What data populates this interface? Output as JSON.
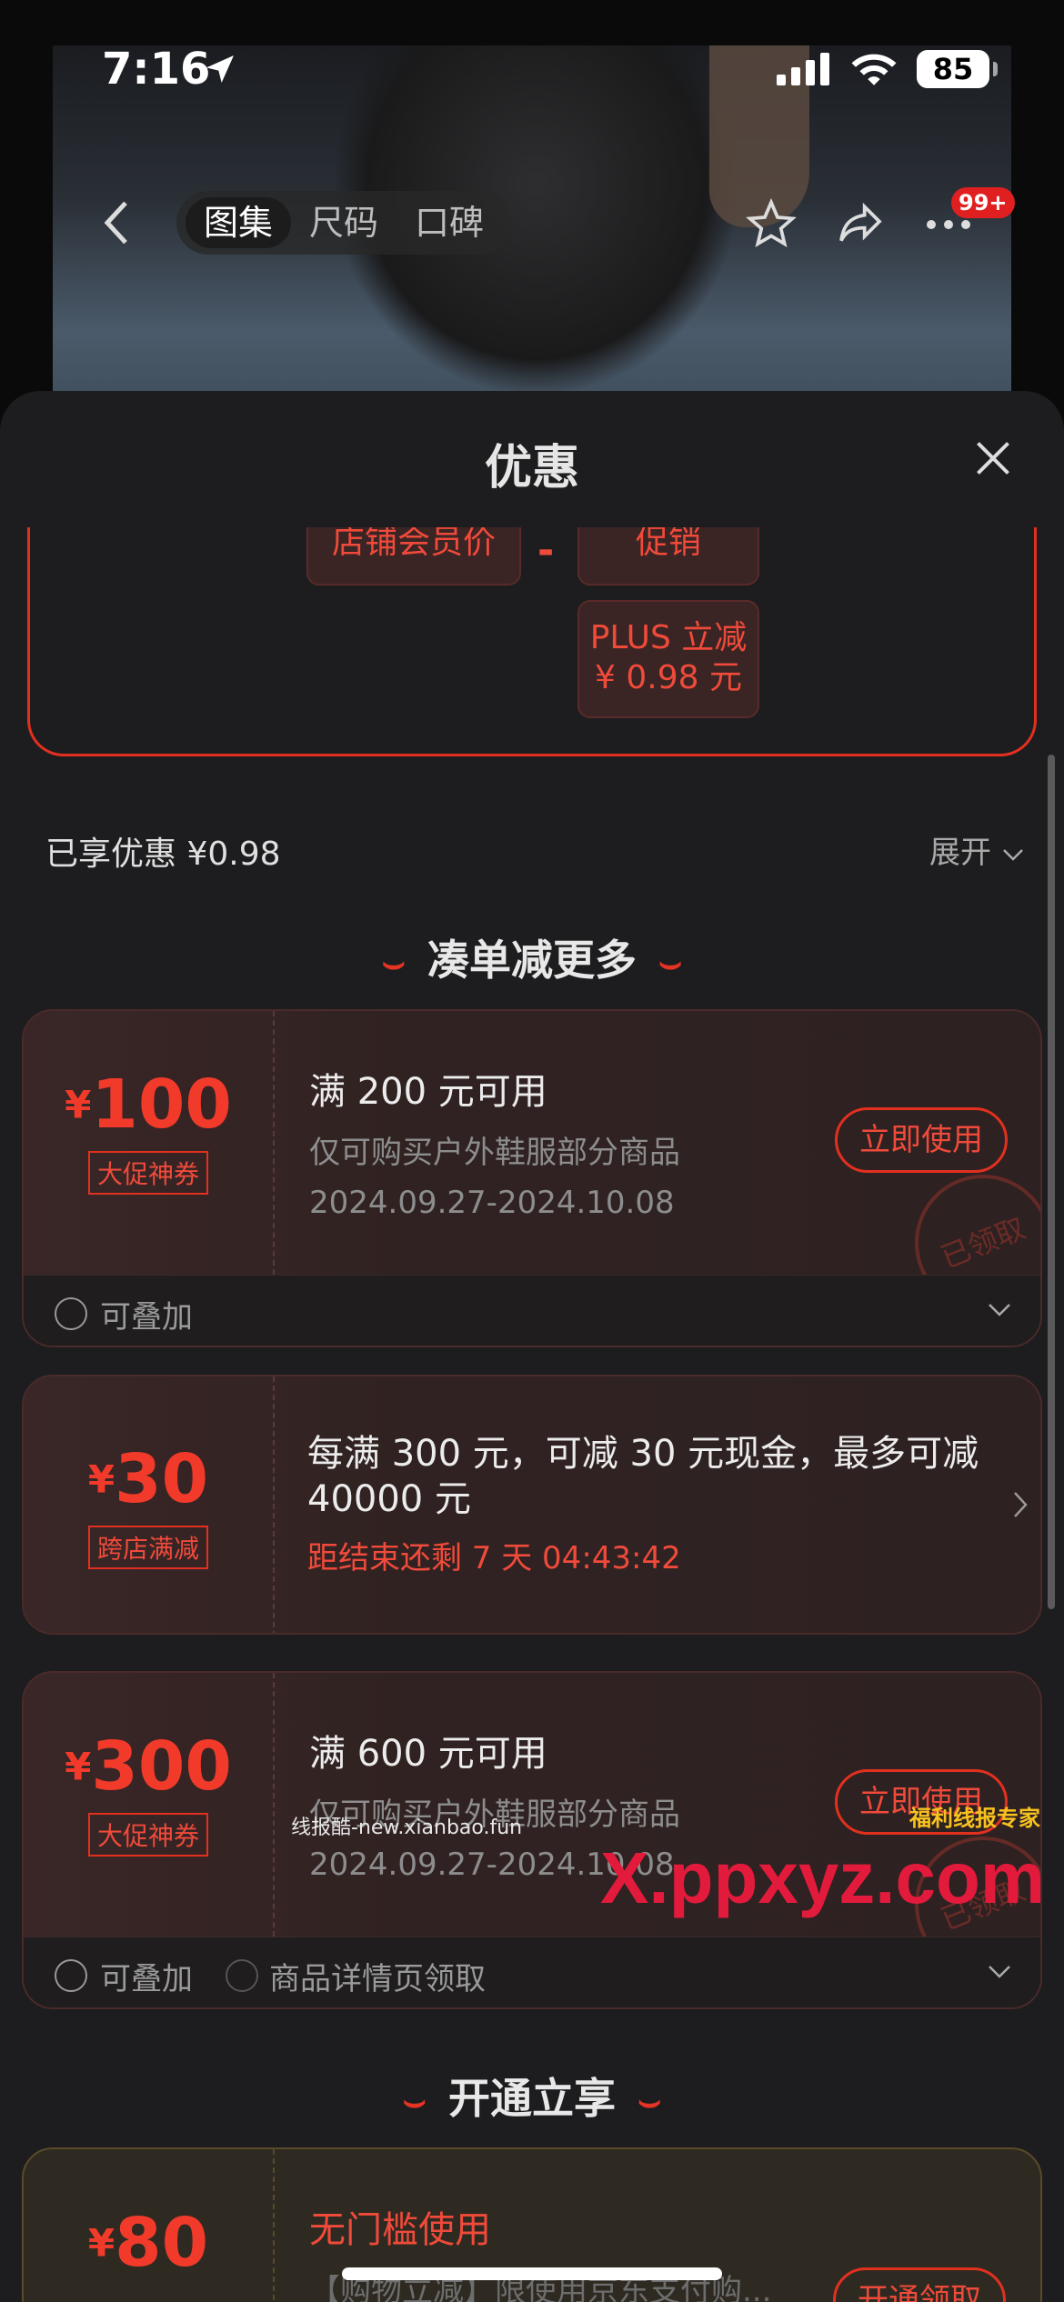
{
  "status_bar": {
    "time": "7:16",
    "battery": "85"
  },
  "nav": {
    "tabs": [
      "图集",
      "尺码",
      "口碑"
    ],
    "active_tab": 0,
    "badge": "99+"
  },
  "sheet": {
    "title": "优惠"
  },
  "price_breakdown": {
    "member_price_label": "店铺会员价",
    "promo_label": "促销",
    "plus_line1": "PLUS 立减",
    "plus_line2": "¥ 0.98 元",
    "operator": "-"
  },
  "summary": {
    "enjoyed": "已享优惠 ¥0.98",
    "expand": "展开"
  },
  "sections": {
    "more": "凑单减更多",
    "open": "开通立享"
  },
  "coupons": [
    {
      "yen": "¥",
      "amount": "100",
      "tag": "大促神券",
      "line1": "满 200 元可用",
      "line2": "仅可购买户外鞋服部分商品",
      "line3": "2024.09.27-2024.10.08",
      "button": "立即使用",
      "stamp": "已领取",
      "foot": [
        "可叠加"
      ]
    },
    {
      "yen": "¥",
      "amount": "30",
      "tag": "跨店满减",
      "line1": "每满 300 元，可减 30 元现金，最多可减 40000 元",
      "countdown": "距结束还剩 7 天 04:43:42"
    },
    {
      "yen": "¥",
      "amount": "300",
      "tag": "大促神券",
      "line1": "满 600 元可用",
      "line2": "仅可购买户外鞋服部分商品",
      "line3": "2024.09.27-2024.10.08",
      "button": "立即使用",
      "stamp": "已领取",
      "foot": [
        "可叠加",
        "商品详情页领取"
      ]
    },
    {
      "yen": "¥",
      "amount": "80",
      "line1": "无门槛使用",
      "line2": "【购物立减】限使用京东支付购...",
      "button": "开通领取"
    }
  ],
  "watermarks": {
    "site": "线报酷-new.xianbao.fun",
    "brand": "X.ppxyz.com",
    "brand_small": "福利线报专家"
  },
  "colors": {
    "accent": "#e2301f",
    "sheet_bg": "#1d1d1f",
    "coupon_bg": "#2b2122"
  }
}
